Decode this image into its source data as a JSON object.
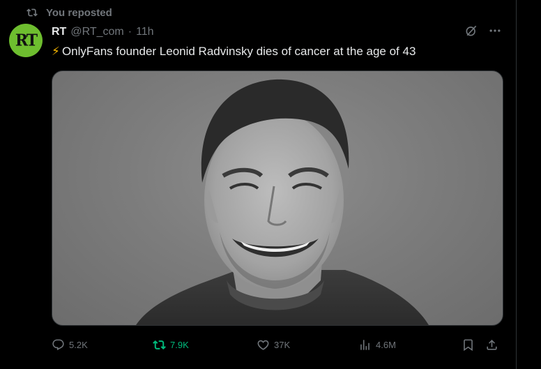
{
  "repost_banner": {
    "text": "You reposted",
    "icon": "repost-icon"
  },
  "author": {
    "avatar_text": "RT",
    "display_name": "RT",
    "handle": "@RT_com",
    "separator": "·",
    "time": "11h",
    "avatar_color": "#6ebe2f"
  },
  "tweet": {
    "emoji": "⚡",
    "text": "OnlyFans founder Leonid Radvinsky dies of cancer at the age of 43"
  },
  "header_actions": {
    "grok_icon": "grok-icon",
    "more_icon": "more-icon"
  },
  "actions": {
    "replies": "5.2K",
    "reposts": "7.9K",
    "likes": "37K",
    "views": "4.6M",
    "repost_active_color": "#00ba7c"
  }
}
